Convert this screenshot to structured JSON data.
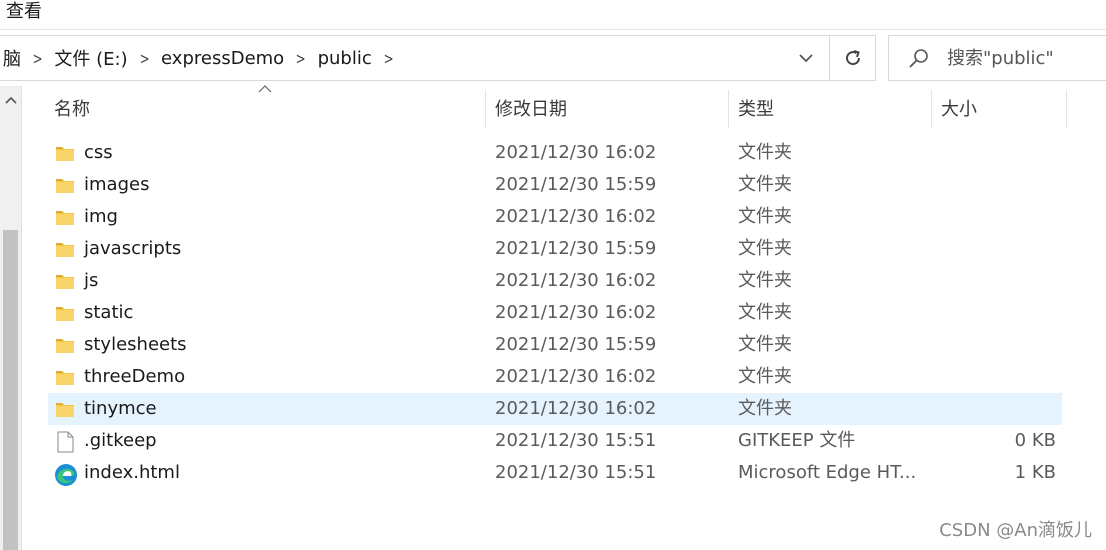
{
  "ribbon": {
    "view_label": "查看"
  },
  "address": {
    "partial_root": "脑",
    "crumbs": [
      "文件 (E:)",
      "expressDemo",
      "public"
    ]
  },
  "search": {
    "placeholder": "搜索\"public\""
  },
  "columns": {
    "name": "名称",
    "date": "修改日期",
    "type": "类型",
    "size": "大小"
  },
  "files": [
    {
      "name": "css",
      "date": "2021/12/30 16:02",
      "type": "文件夹",
      "size": "",
      "icon": "folder-icon"
    },
    {
      "name": "images",
      "date": "2021/12/30 15:59",
      "type": "文件夹",
      "size": "",
      "icon": "folder-icon"
    },
    {
      "name": "img",
      "date": "2021/12/30 16:02",
      "type": "文件夹",
      "size": "",
      "icon": "folder-icon"
    },
    {
      "name": "javascripts",
      "date": "2021/12/30 15:59",
      "type": "文件夹",
      "size": "",
      "icon": "folder-icon"
    },
    {
      "name": "js",
      "date": "2021/12/30 16:02",
      "type": "文件夹",
      "size": "",
      "icon": "folder-icon"
    },
    {
      "name": "static",
      "date": "2021/12/30 16:02",
      "type": "文件夹",
      "size": "",
      "icon": "folder-icon"
    },
    {
      "name": "stylesheets",
      "date": "2021/12/30 15:59",
      "type": "文件夹",
      "size": "",
      "icon": "folder-icon"
    },
    {
      "name": "threeDemo",
      "date": "2021/12/30 16:02",
      "type": "文件夹",
      "size": "",
      "icon": "folder-icon"
    },
    {
      "name": "tinymce",
      "date": "2021/12/30 16:02",
      "type": "文件夹",
      "size": "",
      "icon": "folder-icon"
    },
    {
      "name": ".gitkeep",
      "date": "2021/12/30 15:51",
      "type": "GITKEEP 文件",
      "size": "0 KB",
      "icon": "file-icon"
    },
    {
      "name": "index.html",
      "date": "2021/12/30 15:51",
      "type": "Microsoft Edge HT...",
      "size": "1 KB",
      "icon": "edge-icon"
    }
  ],
  "selected_index": 8,
  "watermark": "CSDN @An滴饭儿",
  "colors": {
    "folder": "#f4c34b",
    "selection": "#e5f3ff",
    "edge": "#1b8fd6"
  }
}
